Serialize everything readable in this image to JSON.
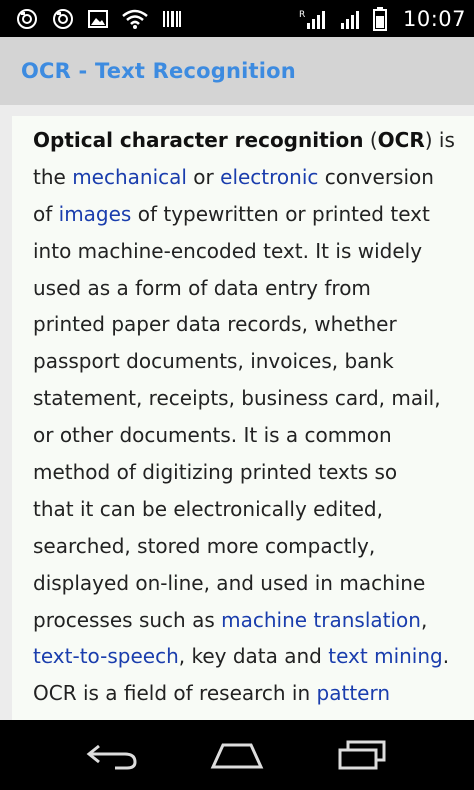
{
  "status_bar": {
    "time": "10:07",
    "roaming_indicator": "R",
    "left_icons": [
      "camera-icon",
      "camera-icon",
      "image-icon",
      "wifi-icon",
      "barcode-icon"
    ],
    "right_icons": [
      "signal-icon",
      "signal-icon",
      "battery-icon"
    ]
  },
  "app": {
    "title": "OCR - Text Recognition"
  },
  "article": {
    "lines": [
      [
        {
          "t": "b",
          "text": "Optical character recognition"
        },
        {
          "t": "n",
          "text": " ("
        },
        {
          "t": "b",
          "text": "OCR"
        },
        {
          "t": "n",
          "text": ") is"
        }
      ],
      [
        {
          "t": "n",
          "text": "the "
        },
        {
          "t": "a",
          "text": "mechanical"
        },
        {
          "t": "n",
          "text": " or "
        },
        {
          "t": "a",
          "text": "electronic"
        },
        {
          "t": "n",
          "text": " conversion"
        }
      ],
      [
        {
          "t": "n",
          "text": "of "
        },
        {
          "t": "a",
          "text": "images"
        },
        {
          "t": "n",
          "text": " of typewritten or printed text"
        }
      ],
      [
        {
          "t": "n",
          "text": "into machine-encoded text. It is widely"
        }
      ],
      [
        {
          "t": "n",
          "text": "used as a form of data entry from"
        }
      ],
      [
        {
          "t": "n",
          "text": "printed paper data records, whether"
        }
      ],
      [
        {
          "t": "n",
          "text": "passport documents, invoices, bank"
        }
      ],
      [
        {
          "t": "n",
          "text": "statement, receipts, business card, mail,"
        }
      ],
      [
        {
          "t": "n",
          "text": "or other documents. It is a common"
        }
      ],
      [
        {
          "t": "n",
          "text": "method of digitizing printed texts so"
        }
      ],
      [
        {
          "t": "n",
          "text": "that it can be electronically edited,"
        }
      ],
      [
        {
          "t": "n",
          "text": "searched, stored more compactly,"
        }
      ],
      [
        {
          "t": "n",
          "text": "displayed on-line, and used in machine"
        }
      ],
      [
        {
          "t": "n",
          "text": "processes such as "
        },
        {
          "t": "a",
          "text": "machine translation"
        },
        {
          "t": "n",
          "text": ","
        }
      ],
      [
        {
          "t": "a",
          "text": "text-to-speech"
        },
        {
          "t": "n",
          "text": ", key data and "
        },
        {
          "t": "a",
          "text": "text mining"
        },
        {
          "t": "n",
          "text": "."
        }
      ],
      [
        {
          "t": "n",
          "text": "OCR is a field of research in "
        },
        {
          "t": "a",
          "text": "pattern"
        }
      ]
    ]
  },
  "nav_bar": {
    "buttons": [
      "back-icon",
      "home-icon",
      "recents-icon"
    ]
  },
  "colors": {
    "title_blue": "#3d8be0",
    "link_blue": "#1a3dad",
    "action_bar_bg": "#d4d4d4",
    "article_bg": "#f8fbf6"
  }
}
